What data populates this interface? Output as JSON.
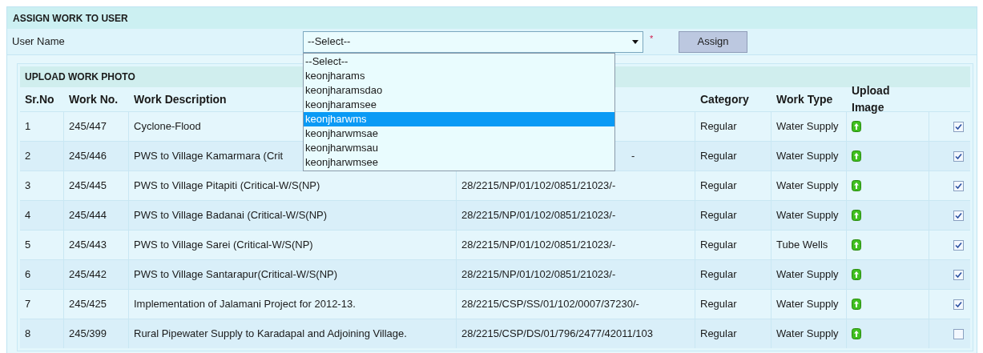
{
  "assign_panel": {
    "title": "ASSIGN WORK TO USER",
    "user_label": "User Name",
    "select_value": "--Select--",
    "required_mark": "*",
    "assign_button": "Assign"
  },
  "dropdown": {
    "options": [
      {
        "label": "--Select--",
        "selected": false
      },
      {
        "label": "keonjharams",
        "selected": false
      },
      {
        "label": "keonjharamsdao",
        "selected": false
      },
      {
        "label": "keonjharamsee",
        "selected": false
      },
      {
        "label": "keonjharwms",
        "selected": true
      },
      {
        "label": "keonjharwmsae",
        "selected": false
      },
      {
        "label": "keonjharwmsau",
        "selected": false
      },
      {
        "label": "keonjharwmsee",
        "selected": false
      }
    ]
  },
  "upload_panel": {
    "title": "UPLOAD WORK PHOTO",
    "columns": [
      "Sr.No",
      "Work No.",
      "Work Description",
      "",
      "Category",
      "Work Type",
      "Upload Image"
    ],
    "rows": [
      {
        "sr": "1",
        "work_no": "245/447",
        "description": "Cyclone-Flood",
        "column_4": "",
        "category": "Regular",
        "work_type": "Water Supply",
        "checked": true
      },
      {
        "sr": "2",
        "work_no": "245/446",
        "description": "PWS to Village Kamarmara (Crit",
        "column_4": "-",
        "category": "Regular",
        "work_type": "Water Supply",
        "checked": true
      },
      {
        "sr": "3",
        "work_no": "245/445",
        "description": "PWS to Village Pitapiti (Critical-W/S(NP)",
        "column_4": "28/2215/NP/01/102/0851/21023/-",
        "category": "Regular",
        "work_type": "Water Supply",
        "checked": true
      },
      {
        "sr": "4",
        "work_no": "245/444",
        "description": "PWS to Village Badanai (Critical-W/S(NP)",
        "column_4": "28/2215/NP/01/102/0851/21023/-",
        "category": "Regular",
        "work_type": "Water Supply",
        "checked": true
      },
      {
        "sr": "5",
        "work_no": "245/443",
        "description": "PWS to Village Sarei (Critical-W/S(NP)",
        "column_4": "28/2215/NP/01/102/0851/21023/-",
        "category": "Regular",
        "work_type": "Tube Wells",
        "checked": true
      },
      {
        "sr": "6",
        "work_no": "245/442",
        "description": "PWS to Village Santarapur(Critical-W/S(NP)",
        "column_4": "28/2215/NP/01/102/0851/21023/-",
        "category": "Regular",
        "work_type": "Water Supply",
        "checked": true
      },
      {
        "sr": "7",
        "work_no": "245/425",
        "description": "Implementation of Jalamani Project for 2012-13.",
        "column_4": "28/2215/CSP/SS/01/102/0007/37230/-",
        "category": "Regular",
        "work_type": "Water Supply",
        "checked": true
      },
      {
        "sr": "8",
        "work_no": "245/399",
        "description": "Rural Pipewater Supply to Karadapal and Adjoining Village.",
        "column_4": "28/2215/CSP/DS/01/796/2477/42011/103",
        "category": "Regular",
        "work_type": "Water Supply",
        "checked": false
      }
    ]
  }
}
